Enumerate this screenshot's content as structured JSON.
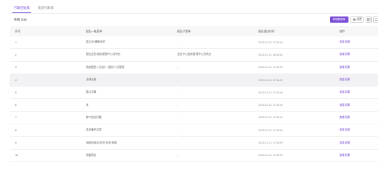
{
  "tabs": [
    {
      "label": "行政区划库",
      "active": true
    },
    {
      "label": "街道行政库",
      "active": false
    }
  ],
  "list_count": {
    "label": "条目",
    "count": "(59)"
  },
  "toolbar": {
    "primary_button": "新增数据库",
    "settings_button": "设置"
  },
  "table": {
    "headers": [
      "序号",
      "报告一级菜单",
      "报告子菜单",
      "报告通过时间",
      "操作"
    ],
    "action_label": "查看测算",
    "rows": [
      {
        "index": "1",
        "menu": "重点业/健康/医疗",
        "submenu": "-",
        "time": "2022-12-23 17:33:16"
      },
      {
        "index": "2",
        "menu": "报告会员/服务管理中心及供应",
        "submenu": "会员中心服务管理中心及供应",
        "time": "2022-12-12 16:40:50"
      },
      {
        "index": "3",
        "menu": "残疾管控人员(统一)管控人员管理",
        "submenu": "-",
        "time": "2022-12-23 17:33:09"
      },
      {
        "index": "4",
        "menu": "法律法规",
        "submenu": "-",
        "time": "2022-12-23 17:33:09"
      },
      {
        "index": "5",
        "menu": "重点涉事",
        "submenu": "-",
        "time": "2022-12-23 17:33:16"
      },
      {
        "index": "6",
        "menu": "其",
        "submenu": "-",
        "time": "2022-12-23 17:33:16"
      },
      {
        "index": "7",
        "menu": "群众信访问题",
        "submenu": "-",
        "time": "2022-12-23 17:33:16"
      },
      {
        "index": "8",
        "menu": "其他事件设置",
        "submenu": "-",
        "time": "2022-12-23 17:33:09"
      },
      {
        "index": "9",
        "menu": "网格员服务/防范/应急/保障",
        "submenu": "-",
        "time": "2022-12-23 17:33:09"
      },
      {
        "index": "10",
        "menu": "测量报告",
        "submenu": "-",
        "time": "2022-12-23 17:33:09"
      }
    ]
  },
  "colors": {
    "accent": "#7b4fd6",
    "header_bg": "#f7f7f8",
    "hover_row": "#f2f2f4"
  },
  "icons": [
    "gear-icon",
    "columns-icon",
    "fullscreen-icon"
  ]
}
